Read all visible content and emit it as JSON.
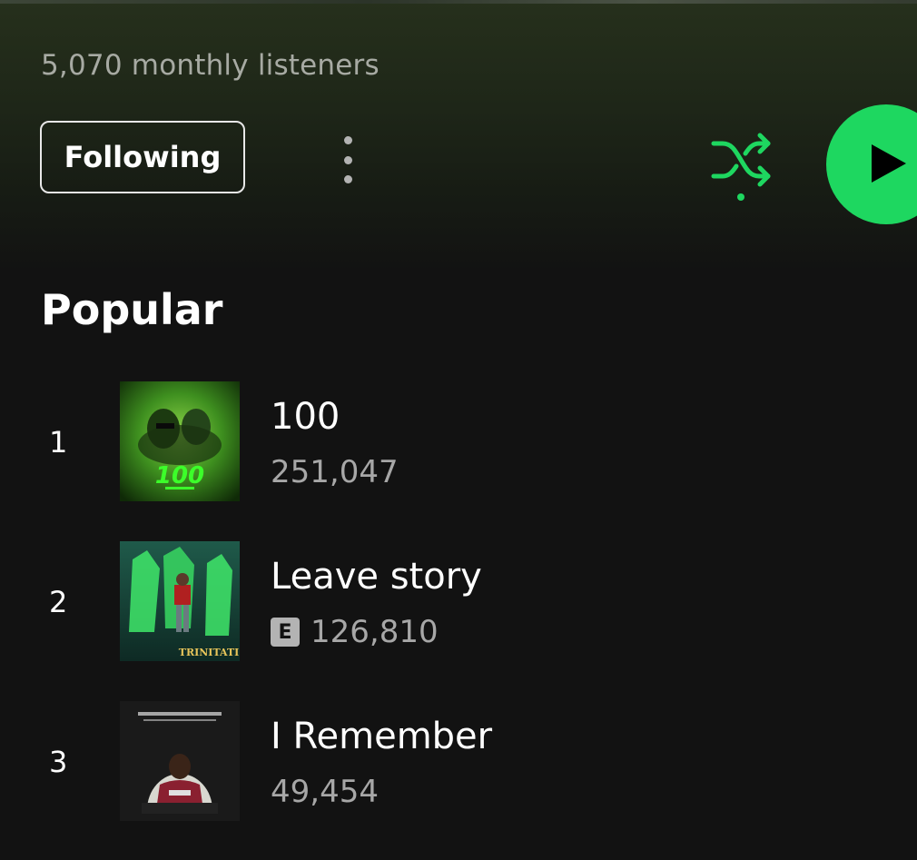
{
  "artist": {
    "monthly_listeners": "5,070 monthly listeners"
  },
  "actions": {
    "follow_label": "Following",
    "more_icon": "more-vertical-icon",
    "shuffle_icon": "shuffle-icon",
    "play_icon": "play-icon",
    "accent_color": "#1ed760"
  },
  "popular": {
    "title": "Popular",
    "tracks": [
      {
        "number": "1",
        "title": "100",
        "plays": "251,047",
        "explicit": false,
        "explicit_label": ""
      },
      {
        "number": "2",
        "title": "Leave story",
        "plays": "126,810",
        "explicit": true,
        "explicit_label": "E"
      },
      {
        "number": "3",
        "title": "I Remember",
        "plays": "49,454",
        "explicit": false,
        "explicit_label": ""
      }
    ]
  }
}
